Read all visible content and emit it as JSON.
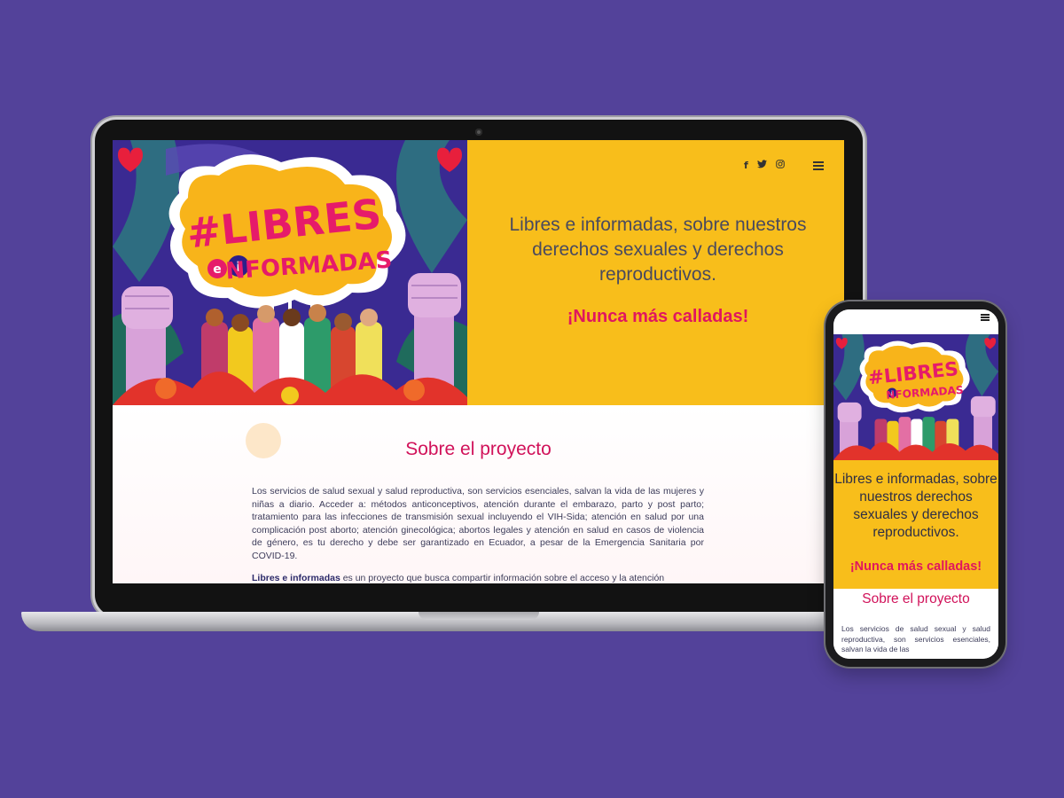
{
  "desktop": {
    "hero": {
      "art": {
        "logo_line1": "#LIBRES",
        "logo_e": "e",
        "logo_i": "i",
        "logo_line2": "NFORMADAS"
      },
      "social": {
        "facebook": "f",
        "twitter": "twitter-icon",
        "instagram": "instagram-icon"
      },
      "heading": "Libres e informadas, sobre nuestros derechos sexuales y derechos reproductivos.",
      "slogan": "¡Nunca más calladas!"
    },
    "about": {
      "title": "Sobre el proyecto",
      "paragraph1": "Los servicios de salud sexual y salud reproductiva, son servicios esenciales, salvan la vida de las mujeres y niñas a diario. Acceder a: métodos anticonceptivos, atención durante el embarazo, parto y post parto; tratamiento para las infecciones de transmisión sexual incluyendo el VIH-Sida; atención en salud por una complicación post aborto; atención ginecológica; abortos legales y atención en salud en casos de violencia de género, es tu derecho y debe ser garantizado en Ecuador, a pesar de la Emergencia Sanitaria por COVID-19.",
      "paragraph2_bold": "Libres e informadas",
      "paragraph2_rest": " es un proyecto que busca compartir información sobre el acceso y la atención"
    }
  },
  "mobile": {
    "heading": "Libres e informadas, sobre nuestros derechos sexuales y derechos reproductivos.",
    "slogan": "¡Nunca más calladas!",
    "about_title": "Sobre el proyecto",
    "about_text": "Los servicios de salud sexual y salud reproductiva, son servicios esenciales, salvan la vida de las"
  },
  "colors": {
    "background": "#53429a",
    "panel_yellow": "#f8be1b",
    "accent_pink": "#e0165f",
    "art_purple": "#3a2a92"
  }
}
